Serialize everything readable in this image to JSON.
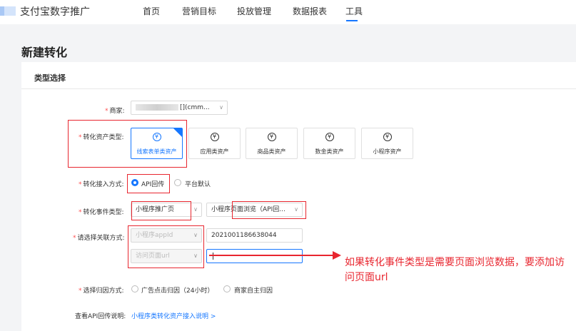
{
  "brand": "支付宝数字推广",
  "nav": [
    "首页",
    "营销目标",
    "投放管理",
    "数据报表",
    "工具"
  ],
  "page_title": "新建转化",
  "card_title": "类型选择",
  "merchant": {
    "label": "商家:",
    "value_suffix": "[](cmm...",
    "icon": "chevron-down-icon"
  },
  "asset_type": {
    "label": "转化资产类型:",
    "options": [
      "线索表单类资产",
      "应用类资产",
      "商品类资产",
      "数金类资产",
      "小程序资产"
    ],
    "icon": "yen-icon"
  },
  "access_method": {
    "label": "转化接入方式:",
    "options": [
      "API回传",
      "平台默认"
    ]
  },
  "event_type": {
    "label": "转化事件类型:",
    "primary": "小程序推广页",
    "secondary": "小程序页面浏览（API回...",
    "icon": "chevron-down-icon"
  },
  "association": {
    "label": "请选择关联方式:",
    "appid_placeholder": "小程序appId",
    "appid_value": "2021001186638044",
    "url_placeholder": "访问页面url"
  },
  "attribution": {
    "label": "选择归因方式:",
    "options": [
      "广告点击归因（24小时）",
      "商家自主归因"
    ]
  },
  "help": {
    "label": "查看API回传说明:",
    "link": "小程序类转化资产接入说明 >"
  },
  "annotation": "如果转化事件类型是需要页面浏览数据，要添加访问页面url",
  "colors": {
    "primary": "#1677ff",
    "annotation": "#e8262f"
  }
}
